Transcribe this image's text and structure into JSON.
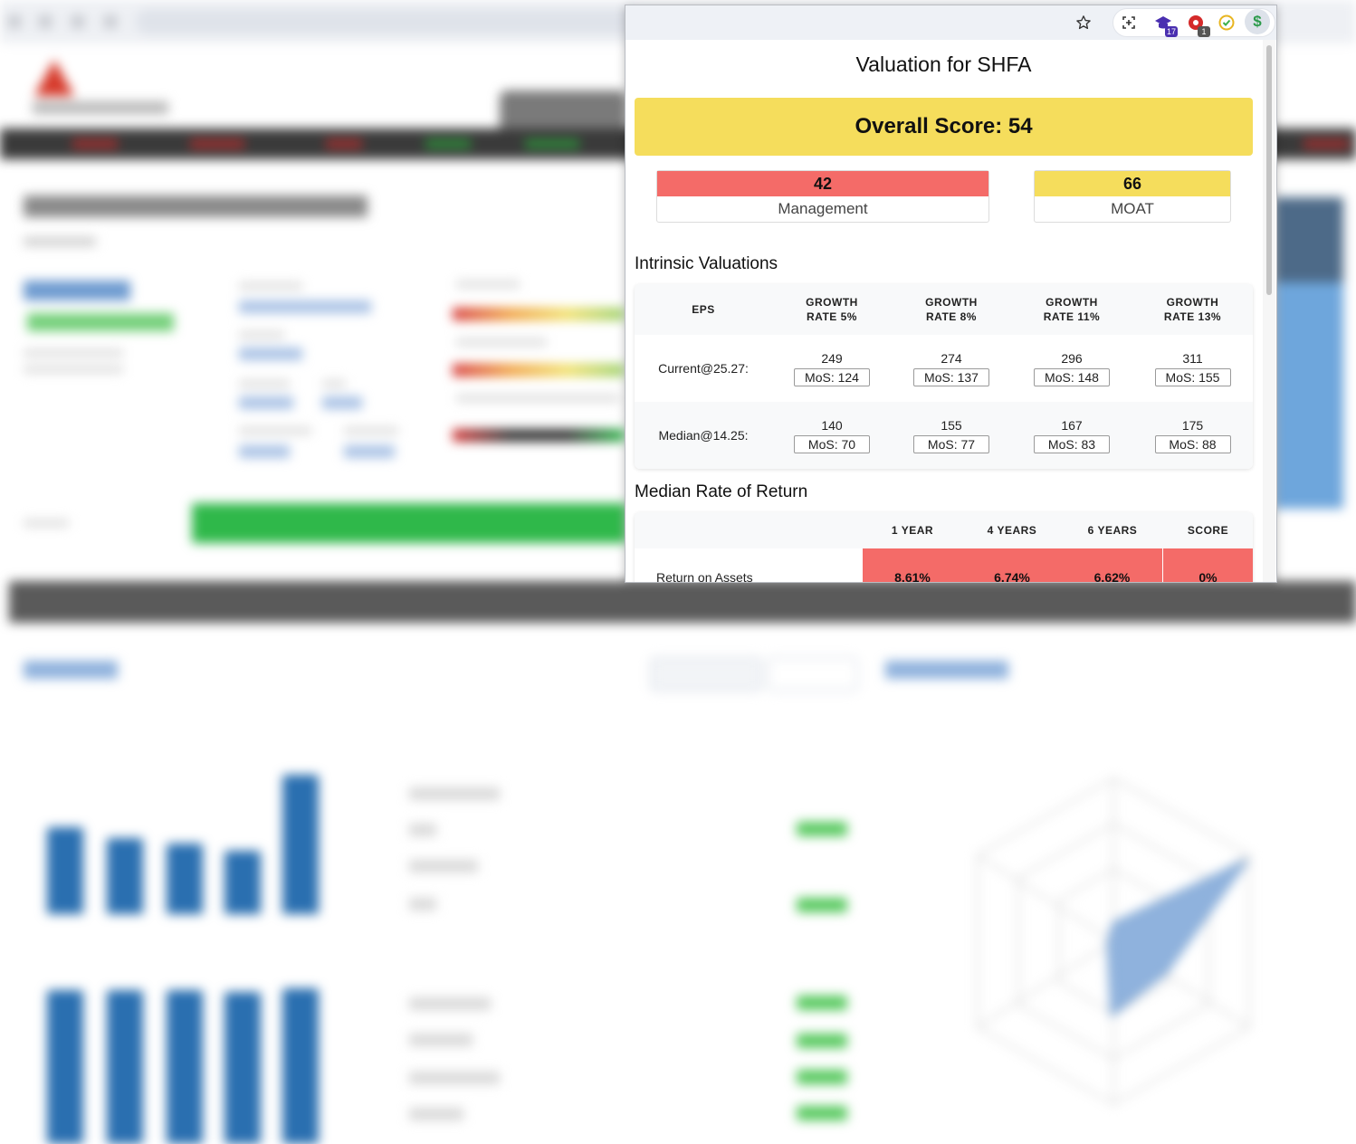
{
  "popup": {
    "title": "Valuation for SHFA",
    "overall_score": "Overall Score: 54",
    "management": {
      "value": "42",
      "label": "Management",
      "color": "#f46b68"
    },
    "moat": {
      "value": "66",
      "label": "MOAT",
      "color": "#f5dd5c"
    },
    "intrinsic": {
      "heading": "Intrinsic Valuations",
      "columns": [
        "EPS",
        "GROWTH RATE 5%",
        "GROWTH RATE 8%",
        "GROWTH RATE 11%",
        "GROWTH RATE 13%"
      ],
      "rows": [
        {
          "label": "Current@25.27:",
          "cells": [
            {
              "value": "249",
              "mos": "MoS: 124"
            },
            {
              "value": "274",
              "mos": "MoS: 137"
            },
            {
              "value": "296",
              "mos": "MoS: 148"
            },
            {
              "value": "311",
              "mos": "MoS: 155"
            }
          ]
        },
        {
          "label": "Median@14.25:",
          "cells": [
            {
              "value": "140",
              "mos": "MoS: 70"
            },
            {
              "value": "155",
              "mos": "MoS: 77"
            },
            {
              "value": "167",
              "mos": "MoS: 83"
            },
            {
              "value": "175",
              "mos": "MoS: 88"
            }
          ]
        }
      ]
    },
    "ror": {
      "heading": "Median Rate of Return",
      "columns": [
        "",
        "1 YEAR",
        "4 YEARS",
        "6 YEARS",
        "SCORE"
      ],
      "rows": [
        {
          "label": "Return on Assets",
          "values": [
            "8.61%",
            "6.74%",
            "6.62%",
            "0%"
          ]
        }
      ]
    }
  },
  "browser": {
    "toolbar_icons": [
      "star-icon",
      "screenshot-icon",
      "extension-graduation-icon",
      "extension-red-icon",
      "extension-clock-icon",
      "extension-dollar-icon"
    ],
    "badges": {
      "graduation": "17",
      "red": "1"
    }
  },
  "colors": {
    "accent_yellow": "#f5dd5c",
    "accent_red": "#f46b68"
  }
}
